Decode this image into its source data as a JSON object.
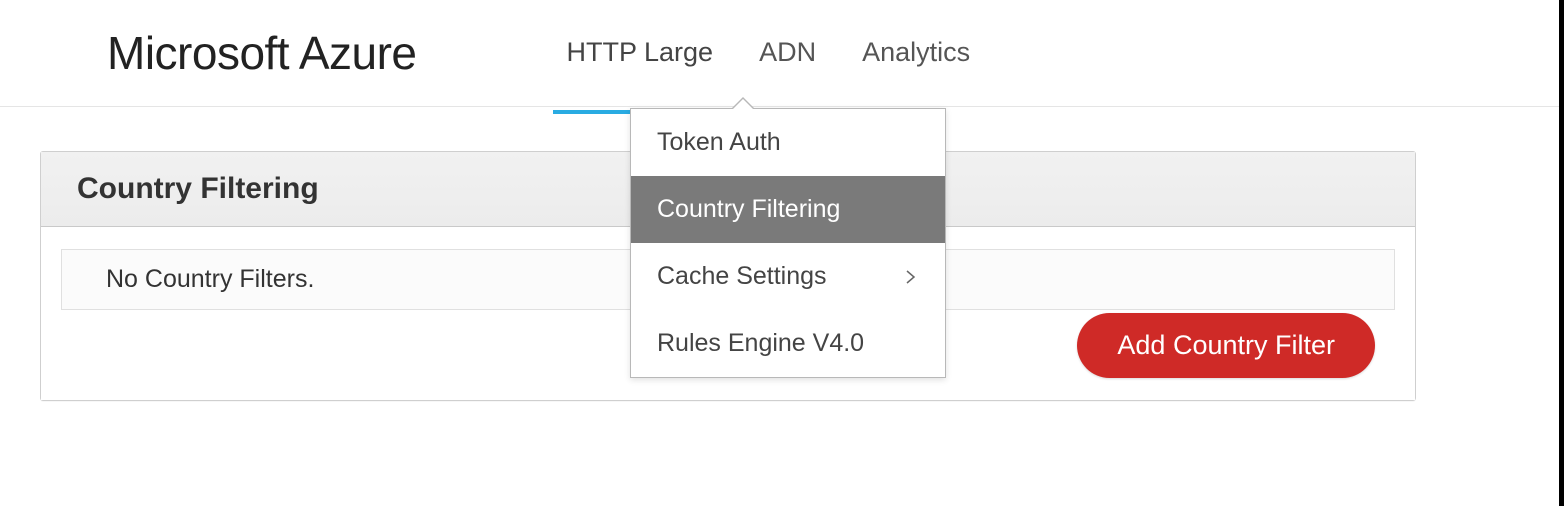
{
  "brand": "Microsoft Azure",
  "tabs": [
    {
      "label": "HTTP Large",
      "active": true
    },
    {
      "label": "ADN",
      "active": false
    },
    {
      "label": "Analytics",
      "active": false
    }
  ],
  "dropdown": {
    "items": [
      {
        "label": "Token Auth",
        "has_submenu": false,
        "selected": false
      },
      {
        "label": "Country Filtering",
        "has_submenu": false,
        "selected": true
      },
      {
        "label": "Cache Settings",
        "has_submenu": true,
        "selected": false
      },
      {
        "label": "Rules Engine V4.0",
        "has_submenu": false,
        "selected": false
      }
    ]
  },
  "panel": {
    "title": "Country Filtering",
    "empty_message": "No Country Filters.",
    "add_button_label": "Add Country Filter"
  }
}
